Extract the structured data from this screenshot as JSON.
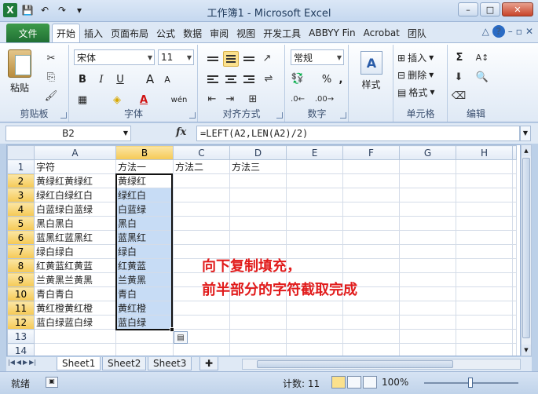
{
  "window": {
    "title": "工作簿1 - Microsoft Excel",
    "controls": {
      "minimize": "–",
      "maximize": "□",
      "close": "✕"
    }
  },
  "tabs": {
    "file": "文件",
    "items": [
      "开始",
      "插入",
      "页面布局",
      "公式",
      "数据",
      "审阅",
      "视图",
      "开发工具",
      "ABBYY Fin",
      "Acrobat",
      "团队"
    ],
    "active_index": 0
  },
  "ribbon": {
    "clipboard": {
      "paste": "粘贴",
      "label": "剪贴板"
    },
    "font": {
      "name": "宋体",
      "size": "11",
      "bold": "B",
      "italic": "I",
      "underline": "U",
      "grow": "A",
      "shrink": "A",
      "label": "字体",
      "wen": "wén"
    },
    "alignment": {
      "label": "对齐方式"
    },
    "number": {
      "format": "常规",
      "percent": "%",
      "comma": ",",
      "label": "数字"
    },
    "styles": {
      "label": "样式",
      "icon": "A"
    },
    "cells": {
      "insert": "插入",
      "delete": "删除",
      "format": "格式",
      "label": "单元格"
    },
    "editing": {
      "sum": "Σ",
      "label": "编辑"
    }
  },
  "formula_bar": {
    "name_box": "B2",
    "fx": "fx",
    "formula": "=LEFT(A2,LEN(A2)/2)"
  },
  "grid": {
    "columns": [
      "A",
      "B",
      "C",
      "D",
      "E",
      "F",
      "G",
      "H"
    ],
    "selected_column": "B",
    "rows": [
      {
        "n": "1",
        "A": "字符",
        "B": "方法一",
        "C": "方法二",
        "D": "方法三"
      },
      {
        "n": "2",
        "A": "黄绿红黄绿红",
        "B": "黄绿红"
      },
      {
        "n": "3",
        "A": "绿红白绿红白",
        "B": "绿红白"
      },
      {
        "n": "4",
        "A": "白蓝绿白蓝绿",
        "B": "白蓝绿"
      },
      {
        "n": "5",
        "A": "黑白黑白",
        "B": "黑白"
      },
      {
        "n": "6",
        "A": "蓝黑红蓝黑红",
        "B": "蓝黑红"
      },
      {
        "n": "7",
        "A": "绿白绿白",
        "B": "绿白"
      },
      {
        "n": "8",
        "A": "红黄蓝红黄蓝",
        "B": "红黄蓝"
      },
      {
        "n": "9",
        "A": "兰黄黑兰黄黑",
        "B": "兰黄黑"
      },
      {
        "n": "10",
        "A": "青白青白",
        "B": "青白"
      },
      {
        "n": "11",
        "A": "黄红橙黄红橙",
        "B": "黄红橙"
      },
      {
        "n": "12",
        "A": "蓝白绿蓝白绿",
        "B": "蓝白绿"
      },
      {
        "n": "13"
      },
      {
        "n": "14"
      }
    ]
  },
  "annotation": {
    "line1": "向下复制填充，",
    "line2": "前半部分的字符截取完成",
    "color": "#e11b1b"
  },
  "sheets": {
    "tabs": [
      "Sheet1",
      "Sheet2",
      "Sheet3"
    ],
    "active_index": 0
  },
  "status": {
    "ready": "就绪",
    "count": "计数: 11",
    "zoom": "100%"
  }
}
